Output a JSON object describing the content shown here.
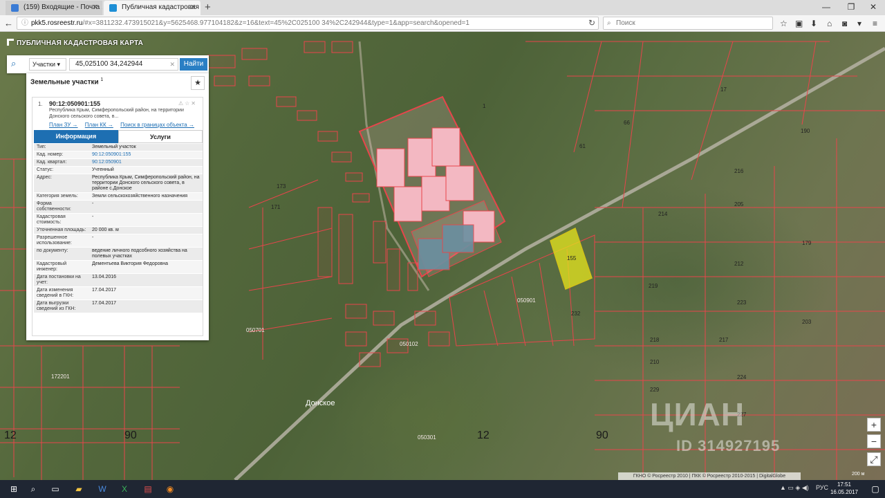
{
  "browser": {
    "tabs": [
      {
        "title": "(159) Входящие - Почта ...",
        "active": false
      },
      {
        "title": "Публичная кадастровая ...",
        "active": true
      }
    ],
    "url_host": "pkk5.rosreestr.ru",
    "url_rest": "/#x=3811232.473915021&y=5625468.977104182&z=16&text=45%2C025100 34%2C242944&type=1&app=search&opened=1",
    "search_placeholder": "Поиск"
  },
  "app": {
    "title": "ПУБЛИЧНАЯ КАДАСТРОВАЯ КАРТА",
    "search": {
      "type": "Участки",
      "query": "45,025100 34,242944",
      "button": "Найти"
    }
  },
  "panel": {
    "heading": "Земельные участки",
    "heading_count": "1",
    "result_index": "1.",
    "cadastral_number": "90:12:050901:155",
    "address_short": "Республика Крым, Симферопольский район, на территории Донского сельского совета, в...",
    "links": [
      "План ЗУ →",
      "План КК →",
      "Поиск в границах объекта →"
    ],
    "tabs": [
      "Информация",
      "Услуги"
    ],
    "rows": [
      {
        "key": "Тип:",
        "value": "Земельный участок"
      },
      {
        "key": "Кад. номер:",
        "value": "90:12:050901:155"
      },
      {
        "key": "Кад. квартал:",
        "value": "90:12:050901"
      },
      {
        "key": "Статус:",
        "value": "Учтенный"
      },
      {
        "key": "Адрес:",
        "value": "Республика Крым, Симферопольский район, на территории Донского сельского совета, в районе с.Донское"
      },
      {
        "key": "Категория земель:",
        "value": "Земли сельскохозяйственного назначения"
      },
      {
        "key": "Форма собственности:",
        "value": "-"
      },
      {
        "key": "Кадастровая стоимость:",
        "value": "-"
      },
      {
        "key": "Уточненная площадь:",
        "value": "20 000 кв. м"
      },
      {
        "key": "Разрешенное использование:",
        "value": "-"
      },
      {
        "key": "по документу:",
        "value": "ведение личного подсобного хозяйства на полевых участках"
      },
      {
        "key": "Кадастровый инженер:",
        "value": "Дементьева Виктория Федоровна"
      },
      {
        "key": "Дата постановки на учет:",
        "value": "13.04.2016"
      },
      {
        "key": "Дата изменения сведений в ГКН:",
        "value": "17.04.2017"
      },
      {
        "key": "Дата выгрузки сведений из ГКН:",
        "value": "17.04.2017"
      }
    ]
  },
  "map": {
    "labels": {
      "q1": "050901",
      "q2": "050102",
      "q3": "050701",
      "q4": "050301",
      "q5": "172201",
      "big1": "12",
      "big2": "90",
      "big3": "12",
      "big4": "90",
      "place": "Донское",
      "p155": "155",
      "p190": "190",
      "p17": "17",
      "p66": "66",
      "p61": "61",
      "p1": "1",
      "p216": "216",
      "p205": "205",
      "p212": "212",
      "p223": "223",
      "p217": "217",
      "p224": "224",
      "p227": "227",
      "p219": "219",
      "p214": "214",
      "p218": "218",
      "p210": "210",
      "p229": "229",
      "p179": "179",
      "p203": "203",
      "p171": "171",
      "p173": "173",
      "p232": "232"
    },
    "copyright": "ГКНО © Росреестр 2010 | ПКК © Росреестр 2010-2015 | DigitalGlobe",
    "scale": "200 м",
    "zoom_in": "+",
    "zoom_out": "−",
    "watermark": "ЦИАН",
    "watermark_id": "ID 314927195"
  },
  "taskbar": {
    "lang": "РУС",
    "time": "17:51",
    "date": "16.05.2017"
  },
  "colors": {
    "parcel_line": "#e8454b",
    "selected_fill": "#e6e61e",
    "panel_accent": "#1e6fb2"
  }
}
